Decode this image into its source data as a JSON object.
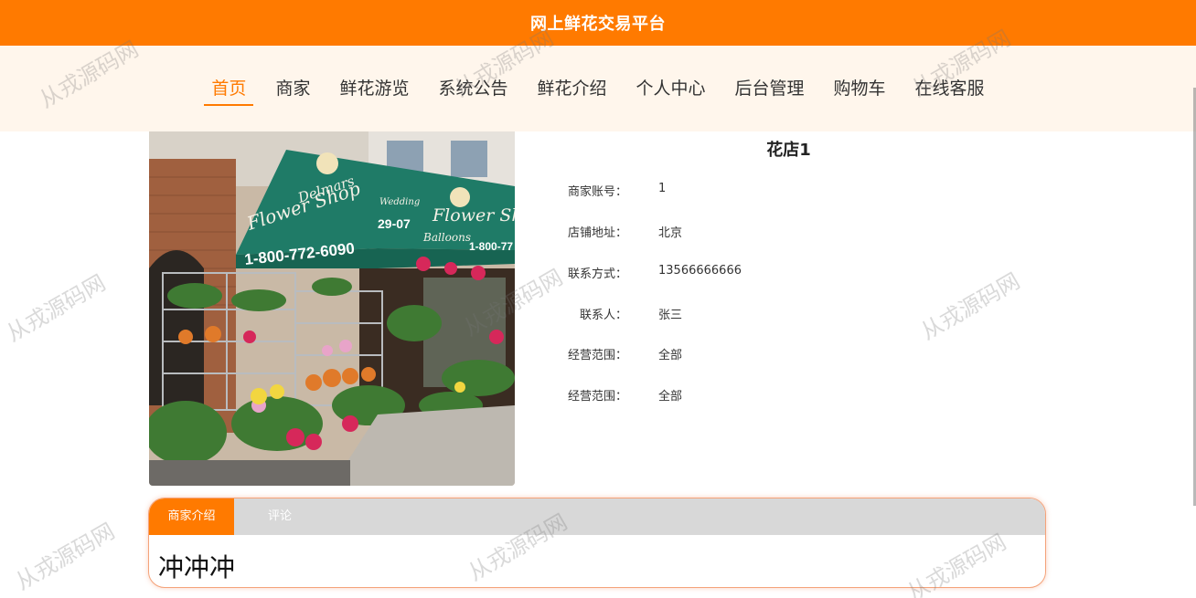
{
  "header": {
    "title": "网上鲜花交易平台"
  },
  "nav": {
    "items": [
      {
        "label": "首页",
        "active": true
      },
      {
        "label": "商家",
        "active": false
      },
      {
        "label": "鲜花游览",
        "active": false
      },
      {
        "label": "系统公告",
        "active": false
      },
      {
        "label": "鲜花介绍",
        "active": false
      },
      {
        "label": "个人中心",
        "active": false
      },
      {
        "label": "后台管理",
        "active": false
      },
      {
        "label": "购物车",
        "active": false
      },
      {
        "label": "在线客服",
        "active": false
      }
    ]
  },
  "shop": {
    "photo_text": {
      "awning_line1": "Delmars",
      "awning_line2": "Flower Shop",
      "phone": "1-800-772-6090",
      "address_no": "29-07",
      "side_sign1": "Wedding",
      "side_sign2": "Flower Sh",
      "side_sign3": "Balloons",
      "side_phone": "1-800-77"
    },
    "name": "花店1",
    "fields": [
      {
        "label": "商家账号：",
        "value": "1"
      },
      {
        "label": "店铺地址：",
        "value": "北京"
      },
      {
        "label": "联系方式：",
        "value": "13566666666"
      },
      {
        "label": "联系人：",
        "value": "张三"
      },
      {
        "label": "经营范围：",
        "value": "全部"
      },
      {
        "label": "经营范围：",
        "value": "全部"
      }
    ]
  },
  "tabs": {
    "items": [
      {
        "label": "商家介绍",
        "active": true
      },
      {
        "label": "评论",
        "active": false
      }
    ],
    "content": "冲冲冲"
  },
  "watermark": {
    "text": "从戎源码网"
  },
  "colors": {
    "accent": "#ff7a00",
    "nav_bg": "#fff6ec",
    "tab_bg": "#d8d8d8"
  }
}
